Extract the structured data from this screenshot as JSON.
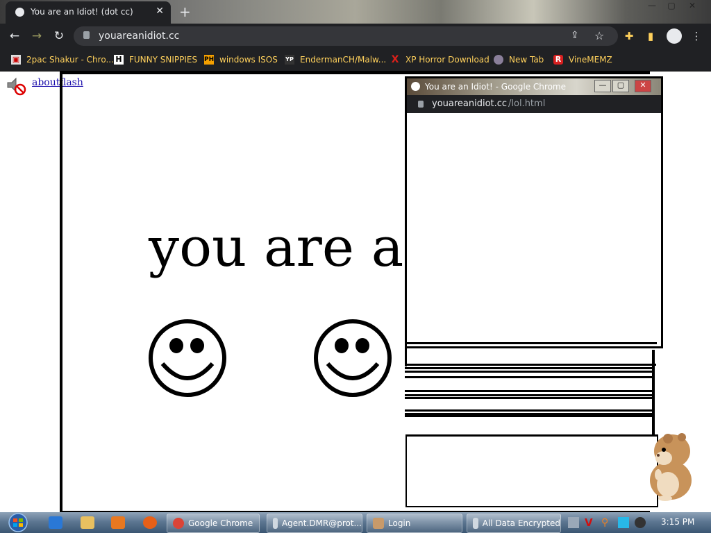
{
  "browser": {
    "tab_title": "You are an Idiot! (dot cc)",
    "tab_close": "✕",
    "new_tab": "+",
    "url": "youareanidiot.cc",
    "window_controls": {
      "minimize": "—",
      "maximize": "▢",
      "close": "✕"
    }
  },
  "bookmarks": [
    {
      "label": "2pac Shakur - Chro...",
      "icon": "folder-icon"
    },
    {
      "label": "FUNNY SNIPPIES",
      "icon": "h-icon"
    },
    {
      "label": "windows ISOS",
      "icon": "ph-icon"
    },
    {
      "label": "EndermanCH/Malw...",
      "icon": "yp-icon"
    },
    {
      "label": "XP Horror Download",
      "icon": "x-icon"
    },
    {
      "label": "New Tab",
      "icon": "globe-icon"
    },
    {
      "label": "VineMEMZ",
      "icon": "r-icon"
    }
  ],
  "page": {
    "link_about": "about",
    "link_flash": "flash",
    "big_text": "you are an"
  },
  "popup": {
    "title": "You are an Idiot! - Google Chrome",
    "url_host": "youareanidiot.cc",
    "url_path": "/lol.html",
    "controls": {
      "minimize": "—",
      "maximize": "▢",
      "close": "✕"
    }
  },
  "taskbar": {
    "items": [
      {
        "label": "Google Chrome"
      },
      {
        "label": "Agent.DMR@prot..."
      },
      {
        "label": "Login"
      },
      {
        "label": "All Data Encrypted"
      }
    ],
    "clock": "3:15 PM"
  }
}
